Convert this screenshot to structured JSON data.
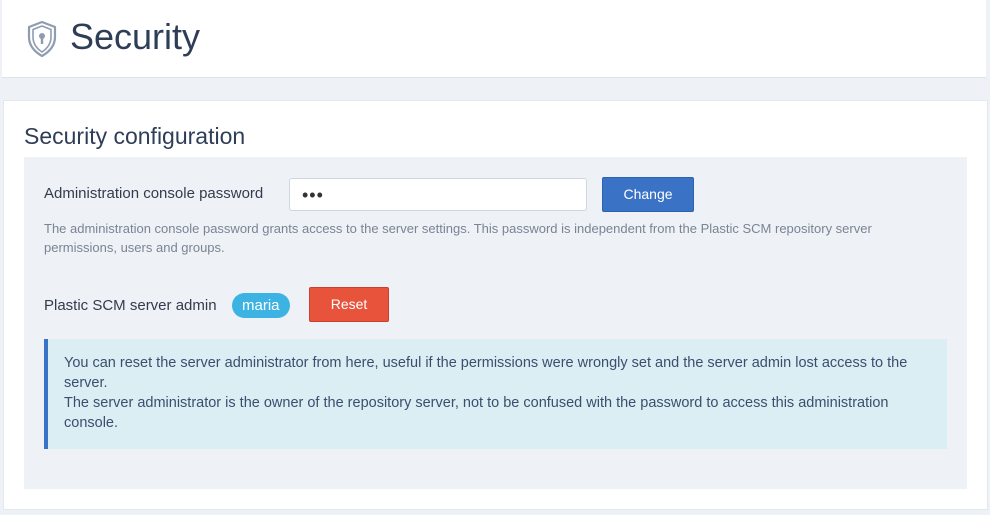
{
  "header": {
    "title": "Security",
    "icon": "shield-icon"
  },
  "security_config": {
    "title": "Security configuration",
    "password": {
      "label": "Administration console password",
      "value": "•••",
      "change_label": "Change",
      "help": "The administration console password grants access to the server settings. This password is independent from the Plastic SCM repository server permissions, users and groups."
    },
    "admin": {
      "label": "Plastic SCM server admin",
      "user": "maria",
      "reset_label": "Reset"
    },
    "alert": {
      "line1": "You can reset the server administrator from here, useful if the permissions were wrongly set and the server admin lost access to the server.",
      "line2": "The server administrator is the owner of the repository server, not to be confused with the password to access this administration console."
    }
  },
  "colors": {
    "primary": "#3a73c5",
    "danger": "#e8533c",
    "badge": "#3db3e3",
    "alert_bg": "#dbeef4"
  }
}
